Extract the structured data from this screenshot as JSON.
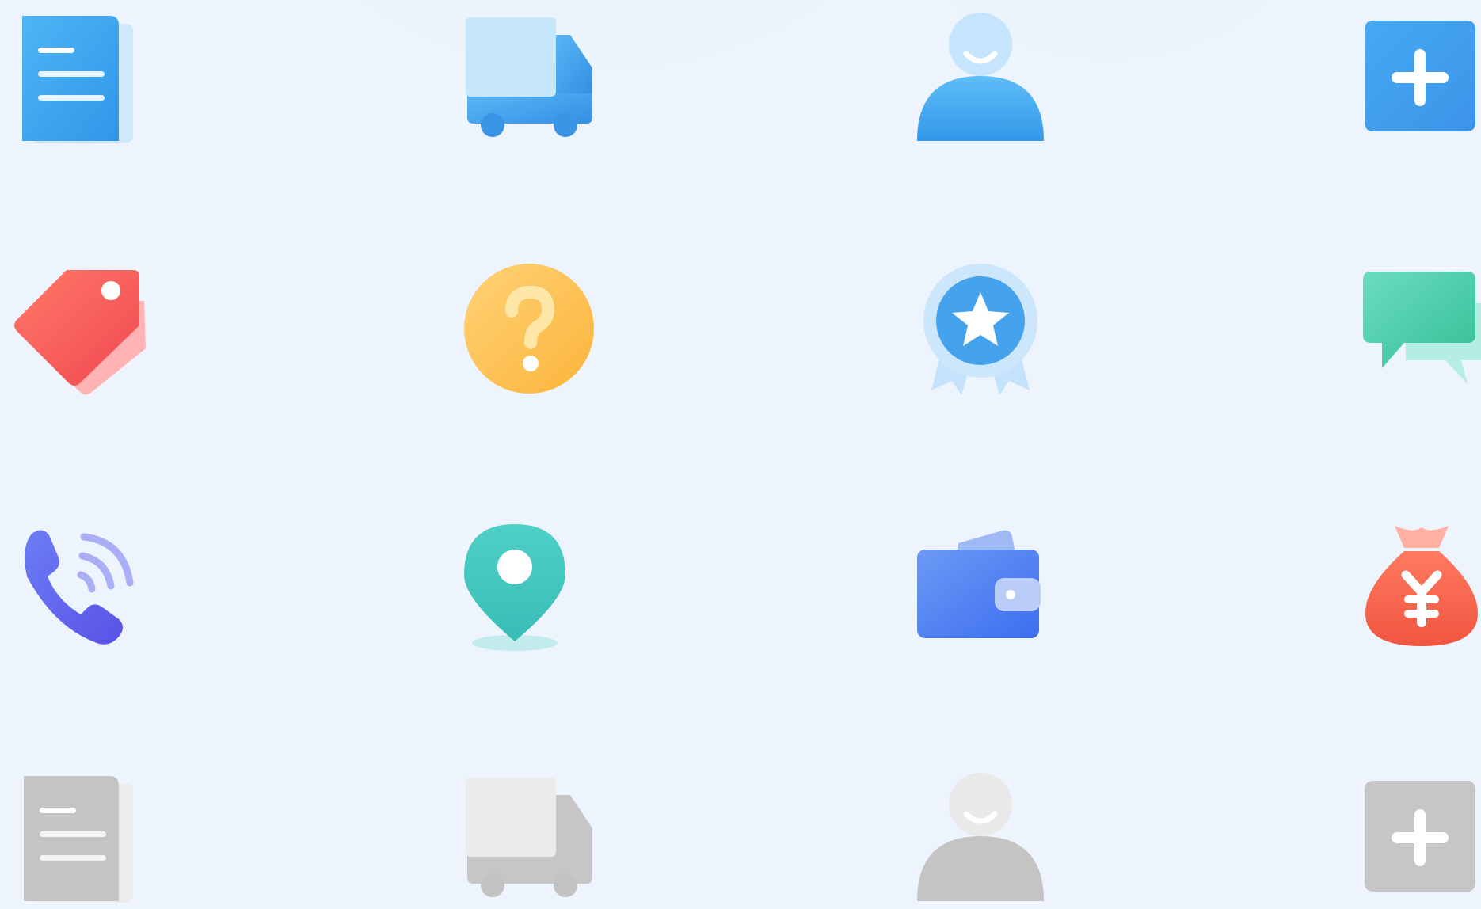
{
  "icons": [
    {
      "name": "document",
      "color": "#3aa7f2"
    },
    {
      "name": "truck",
      "color": "#3fa8f0"
    },
    {
      "name": "user",
      "color": "#3fa7ef"
    },
    {
      "name": "add",
      "color": "#3f9ff0"
    },
    {
      "name": "tag",
      "color": "#f5595a"
    },
    {
      "name": "question",
      "color": "#fcbd4a"
    },
    {
      "name": "award-badge",
      "color": "#4aa4ed"
    },
    {
      "name": "chat",
      "color": "#42c9a4"
    },
    {
      "name": "phone",
      "color": "#6a6ef0"
    },
    {
      "name": "location-pin",
      "color": "#3ec6c1"
    },
    {
      "name": "wallet",
      "color": "#4f82f0"
    },
    {
      "name": "money-bag",
      "color": "#f45e4a",
      "symbol": "¥"
    },
    {
      "name": "document-disabled",
      "color": "#c3c3c3"
    },
    {
      "name": "truck-disabled",
      "color": "#c3c3c3"
    },
    {
      "name": "user-disabled",
      "color": "#c3c3c3"
    },
    {
      "name": "add-disabled",
      "color": "#c3c3c3"
    }
  ]
}
